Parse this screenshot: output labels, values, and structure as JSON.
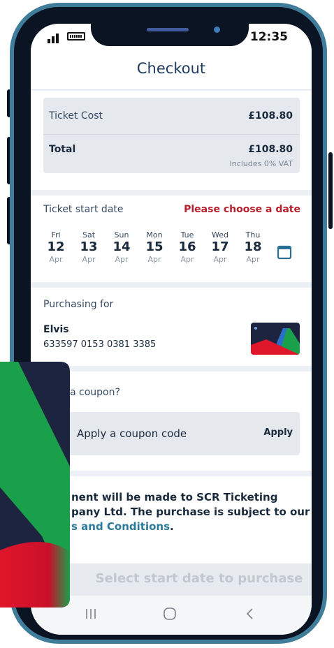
{
  "status_bar": {
    "time": "12:35"
  },
  "app_bar": {
    "title": "Checkout"
  },
  "cost": {
    "ticket_cost_label": "Ticket Cost",
    "ticket_cost_value": "£108.80",
    "total_label": "Total",
    "total_value": "£108.80",
    "vat_note": "Includes 0% VAT"
  },
  "start_date": {
    "label": "Ticket start date",
    "error": "Please choose a date",
    "days": [
      {
        "name": "Fri",
        "num": "12",
        "month": "Apr"
      },
      {
        "name": "Sat",
        "num": "13",
        "month": "Apr"
      },
      {
        "name": "Sun",
        "num": "14",
        "month": "Apr"
      },
      {
        "name": "Mon",
        "num": "15",
        "month": "Apr"
      },
      {
        "name": "Tue",
        "num": "16",
        "month": "Apr"
      },
      {
        "name": "Wed",
        "num": "17",
        "month": "Apr"
      },
      {
        "name": "Thu",
        "num": "18",
        "month": "Apr"
      }
    ],
    "calendar_icon": "calendar-icon"
  },
  "purchasing": {
    "label": "Purchasing for",
    "name": "Elvis",
    "card_number": "633597 0153 0381 3385"
  },
  "coupon": {
    "question": "a coupon?",
    "input_placeholder": "Apply a coupon code",
    "apply_label": "Apply"
  },
  "terms": {
    "line1": "nent will be made to SCR Ticketing",
    "line2": "pany Ltd. The purchase is subject to our",
    "link": "s and Conditions",
    "end": "."
  },
  "purchase_button": {
    "label": "Select start date to purchase"
  },
  "nav_bar": {
    "icons": [
      "recent-apps-icon",
      "home-icon",
      "back-icon"
    ]
  },
  "colors": {
    "phone_frame": "#3f7d9a",
    "title": "#1e3a5c",
    "error": "#b61f2b",
    "link": "#2c7a99",
    "card_navy": "#1c2440",
    "card_green": "#1aa04a",
    "card_red": "#e0162b"
  }
}
